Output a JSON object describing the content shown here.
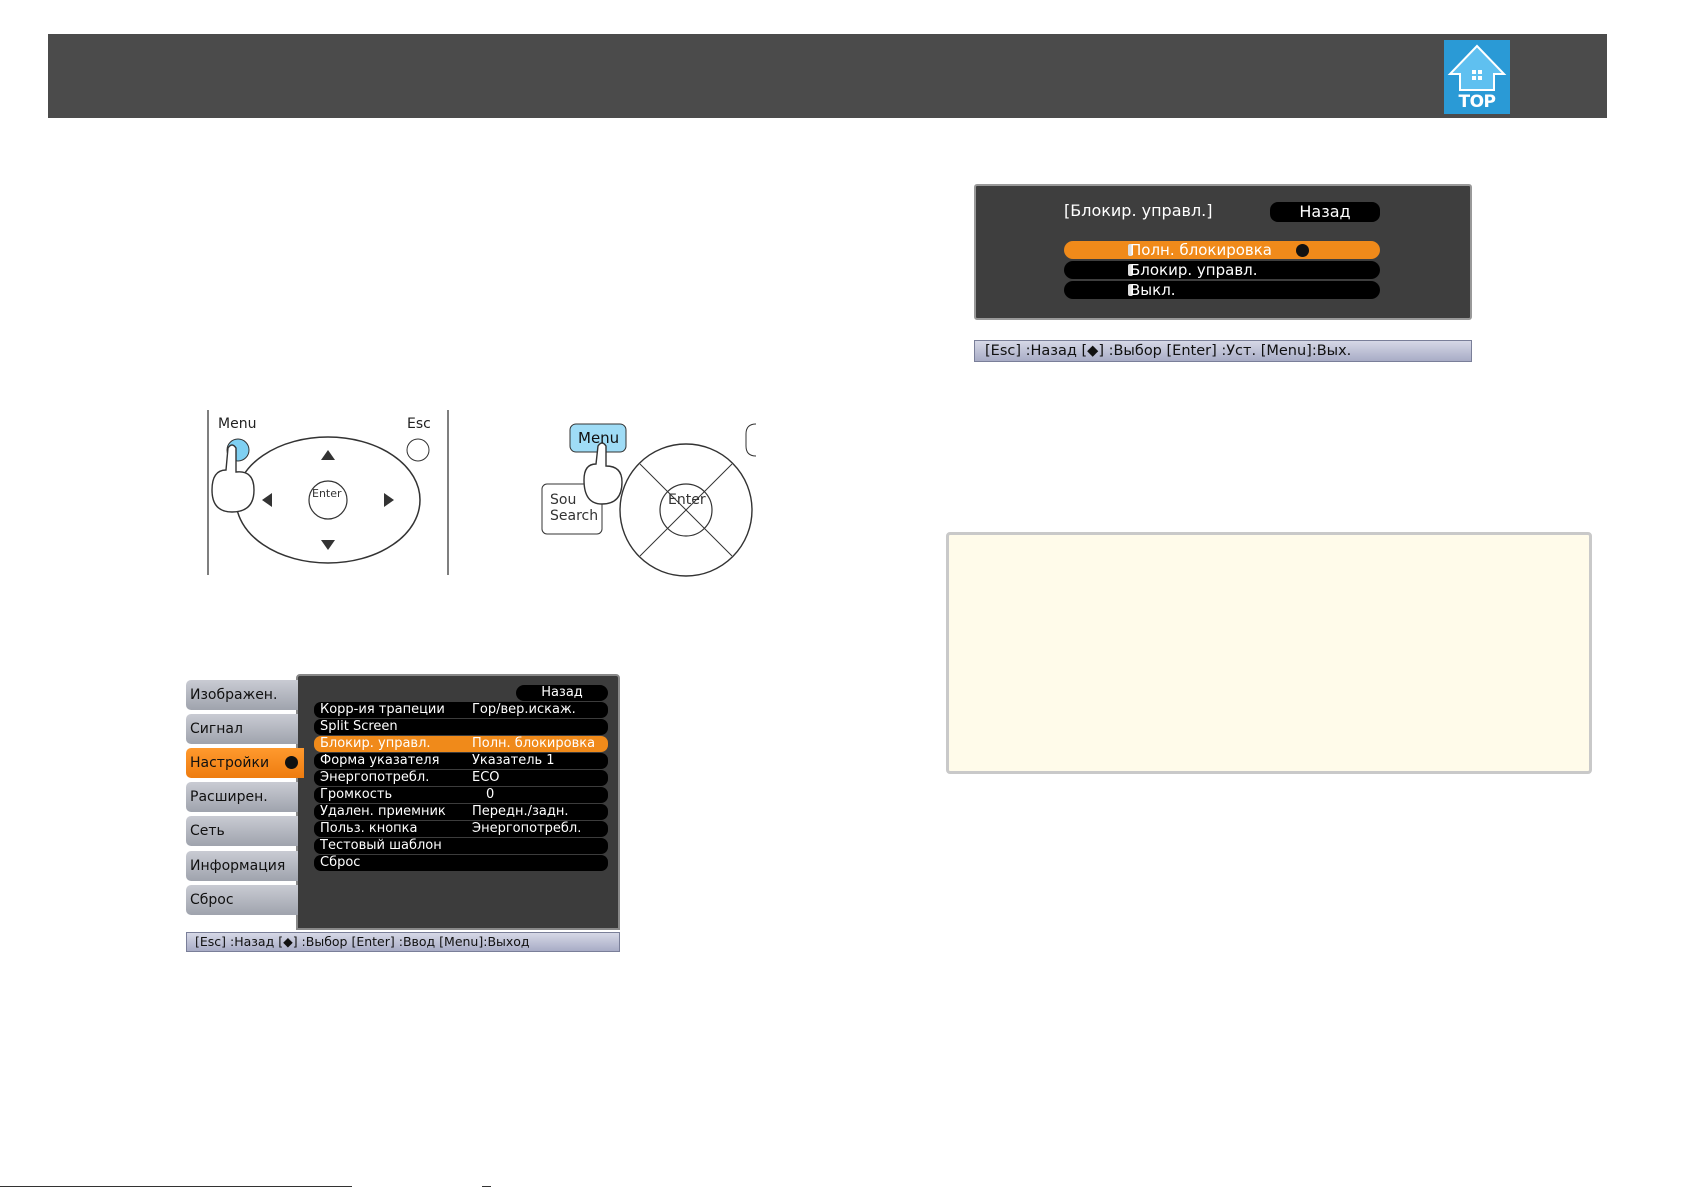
{
  "header": {
    "logo_text": "TOP"
  },
  "remote": {
    "menu_label": "Menu",
    "esc_label": "Esc",
    "enter_label": "Enter"
  },
  "panel": {
    "menu_label": "Menu",
    "source_label_1": "Sou",
    "source_label_2": "Search",
    "enter_label": "Enter"
  },
  "settings_menu": {
    "tabs": [
      "Изображен.",
      "Сигнал",
      "Настройки",
      "Расширен.",
      "Сеть",
      "Информация",
      "Сброс"
    ],
    "back_label": "Назад",
    "rows": [
      {
        "key": "Корр-ия трапеции",
        "value": "Гор/вер.искаж."
      },
      {
        "key": "Split Screen",
        "value": ""
      },
      {
        "key": "Блокир. управл.",
        "value": "Полн. блокировка"
      },
      {
        "key": "Форма указателя",
        "value": "Указатель 1"
      },
      {
        "key": "Энергопотребл.",
        "value": "ECO"
      },
      {
        "key": "Громкость",
        "value": "0"
      },
      {
        "key": "Удален. приемник",
        "value": "Передн./задн."
      },
      {
        "key": "Польз. кнопка",
        "value": "Энергопотребл."
      },
      {
        "key": "Тестовый шаблон",
        "value": ""
      },
      {
        "key": "Сброс",
        "value": ""
      }
    ],
    "hints": "[Esc] :Назад  [◆] :Выбор  [Enter] :Ввод  [Menu]:Выход"
  },
  "lock_dialog": {
    "title": "[Блокир. управл.]",
    "back_label": "Назад",
    "options": [
      "Полн. блокировка",
      "Блокир. управл.",
      "Выкл."
    ],
    "hints": "[Esc] :Назад  [◆] :Выбор  [Enter] :Уст.      [Menu]:Вых."
  },
  "colors": {
    "header_bg": "#4b4b4b",
    "accent_orange": "#f08a1a",
    "note_bg": "#fffbea",
    "top_logo": "#2a9ad6"
  }
}
